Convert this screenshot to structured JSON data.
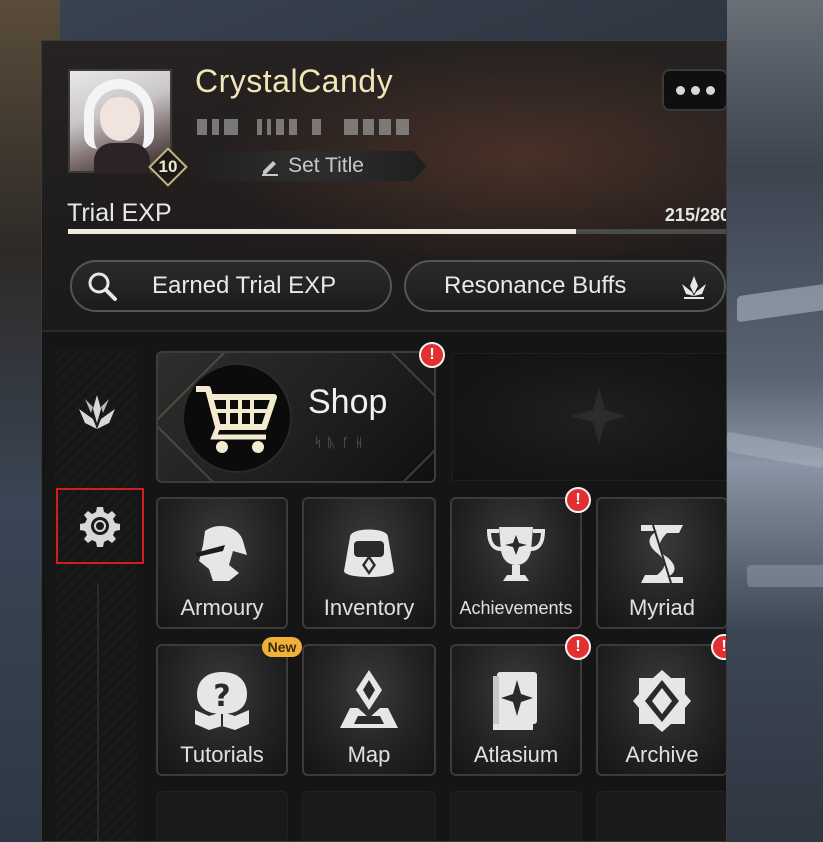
{
  "profile": {
    "username": "CrystalCandy",
    "level": "10",
    "set_title_label": "Set Title"
  },
  "exp": {
    "label": "Trial EXP",
    "value_text": "215/280",
    "current": 215,
    "max": 280
  },
  "buttons": {
    "earned_trial_exp": "Earned Trial EXP",
    "resonance_buffs": "Resonance Buffs"
  },
  "shop": {
    "label": "Shop",
    "runes": "ᛋᚣᚴᚺ",
    "has_alert": true
  },
  "tiles": [
    {
      "id": "armoury",
      "label": "Armoury",
      "icon": "armoury-icon",
      "alert": false,
      "new": false
    },
    {
      "id": "inventory",
      "label": "Inventory",
      "icon": "inventory-icon",
      "alert": false,
      "new": false
    },
    {
      "id": "achievements",
      "label": "Achievements",
      "icon": "trophy-icon",
      "alert": true,
      "new": false
    },
    {
      "id": "myriad",
      "label": "Myriad",
      "icon": "myriad-icon",
      "alert": false,
      "new": false
    },
    {
      "id": "tutorials",
      "label": "Tutorials",
      "icon": "tutorials-icon",
      "alert": false,
      "new": true
    },
    {
      "id": "map",
      "label": "Map",
      "icon": "map-icon",
      "alert": false,
      "new": false
    },
    {
      "id": "atlasium",
      "label": "Atlasium",
      "icon": "atlasium-book-icon",
      "alert": true,
      "new": false
    },
    {
      "id": "archive",
      "label": "Archive",
      "icon": "archive-icon",
      "alert": true,
      "new": false
    }
  ],
  "badges": {
    "alert_glyph": "!",
    "new_label": "New"
  },
  "colors": {
    "username": "#f0e6b7",
    "alert": "#e23030",
    "new_badge": "#f0b13a",
    "highlight_border": "#d21e1e"
  }
}
